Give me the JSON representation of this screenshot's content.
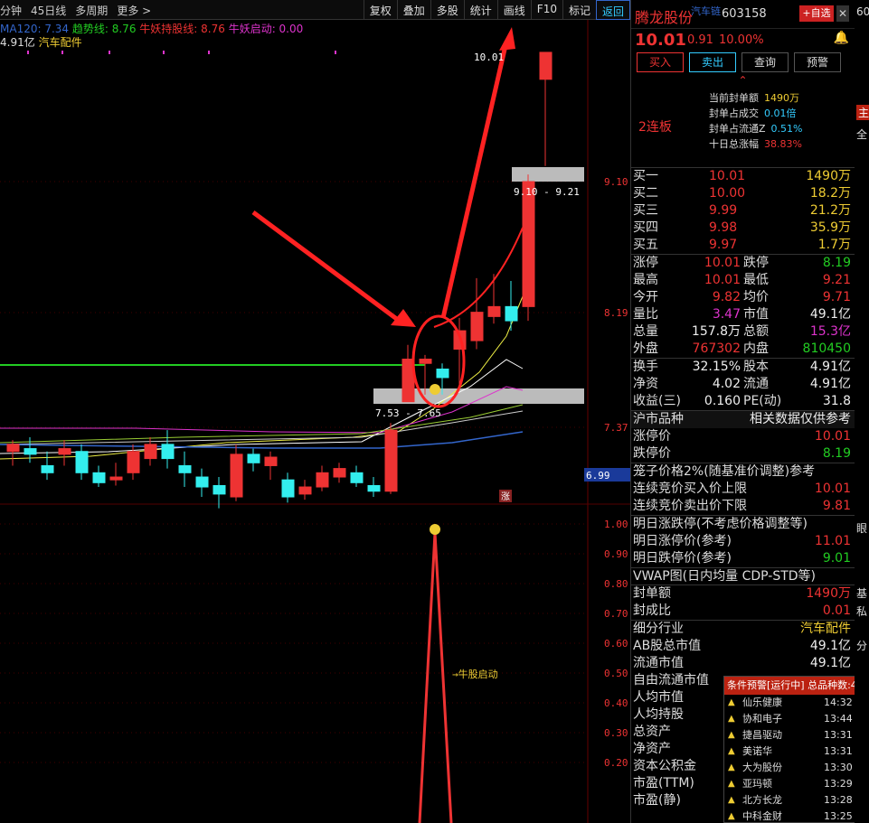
{
  "toolbar": {
    "left": [
      "分钟",
      "45日线",
      "多周期",
      "更多 >"
    ],
    "right": [
      "复权",
      "叠加",
      "多股",
      "统计",
      "画线",
      "F10",
      "标记",
      "返回"
    ]
  },
  "indicators": {
    "ma": "MA120: 7.34",
    "trend": "趋势线: 8.76",
    "holding": "牛妖持股线: 8.76",
    "start": "牛妖启动: 0.00",
    "cap": "4.91亿",
    "sector": "汽车配件"
  },
  "chart": {
    "price_labels": [
      "9.10",
      "8.19",
      "7.37"
    ],
    "current_price_tag": "6.99",
    "zone_top": "9.10 - 9.21",
    "zone_bottom": "7.53 - 7.65",
    "high_label": "10.01",
    "limit_tag": "涨",
    "lower_labels": [
      "1.00",
      "0.90",
      "0.80",
      "0.70",
      "0.60",
      "0.50",
      "0.40",
      "0.30",
      "0.20"
    ],
    "signal_text": "→牛股启动"
  },
  "chart_data": {
    "type": "candlestick",
    "candles": [
      {
        "o": 7.2,
        "c": 7.25,
        "h": 7.28,
        "l": 7.1
      },
      {
        "o": 7.22,
        "c": 7.18,
        "h": 7.3,
        "l": 7.12
      },
      {
        "o": 7.1,
        "c": 7.05,
        "h": 7.2,
        "l": 7.0
      },
      {
        "o": 7.18,
        "c": 7.22,
        "h": 7.28,
        "l": 7.1
      },
      {
        "o": 7.2,
        "c": 7.05,
        "h": 7.25,
        "l": 7.0
      },
      {
        "o": 7.05,
        "c": 6.98,
        "h": 7.1,
        "l": 6.95
      },
      {
        "o": 7.0,
        "c": 7.02,
        "h": 7.12,
        "l": 6.96
      },
      {
        "o": 7.05,
        "c": 7.2,
        "h": 7.25,
        "l": 7.0
      },
      {
        "o": 7.15,
        "c": 7.25,
        "h": 7.3,
        "l": 7.1
      },
      {
        "o": 7.25,
        "c": 7.15,
        "h": 7.35,
        "l": 7.08
      },
      {
        "o": 7.1,
        "c": 7.05,
        "h": 7.2,
        "l": 6.95
      },
      {
        "o": 7.02,
        "c": 6.95,
        "h": 7.08,
        "l": 6.88
      },
      {
        "o": 6.96,
        "c": 6.9,
        "h": 7.02,
        "l": 6.8
      },
      {
        "o": 6.88,
        "c": 7.18,
        "h": 7.25,
        "l": 6.85
      },
      {
        "o": 7.18,
        "c": 7.12,
        "h": 7.22,
        "l": 7.06
      },
      {
        "o": 7.1,
        "c": 7.16,
        "h": 7.2,
        "l": 7.0
      },
      {
        "o": 7.0,
        "c": 6.88,
        "h": 7.05,
        "l": 6.84
      },
      {
        "o": 6.9,
        "c": 6.95,
        "h": 7.0,
        "l": 6.86
      },
      {
        "o": 6.95,
        "c": 7.05,
        "h": 7.1,
        "l": 6.92
      },
      {
        "o": 7.02,
        "c": 7.08,
        "h": 7.12,
        "l": 6.98
      },
      {
        "o": 7.05,
        "c": 6.98,
        "h": 7.1,
        "l": 6.95
      },
      {
        "o": 6.96,
        "c": 6.92,
        "h": 7.02,
        "l": 6.88
      },
      {
        "o": 6.92,
        "c": 7.35,
        "h": 7.4,
        "l": 6.9
      },
      {
        "o": 7.55,
        "c": 7.85,
        "h": 7.95,
        "l": 7.55
      },
      {
        "o": 7.82,
        "c": 7.85,
        "h": 7.88,
        "l": 7.6
      },
      {
        "o": 7.78,
        "c": 7.72,
        "h": 7.82,
        "l": 7.6
      },
      {
        "o": 7.92,
        "c": 8.05,
        "h": 8.14,
        "l": 7.65
      },
      {
        "o": 7.98,
        "c": 8.18,
        "h": 8.42,
        "l": 7.92
      },
      {
        "o": 8.15,
        "c": 8.22,
        "h": 8.45,
        "l": 8.1
      },
      {
        "o": 8.22,
        "c": 8.12,
        "h": 8.4,
        "l": 8.05
      },
      {
        "o": 8.22,
        "c": 9.1,
        "h": 9.15,
        "l": 8.12
      },
      {
        "o": 9.82,
        "c": 10.01,
        "h": 10.01,
        "l": 9.21
      }
    ]
  },
  "panel": {
    "name": "腾龙股份",
    "sub": "汽车链",
    "code": "603158",
    "add_label": "+自选",
    "close": "✕",
    "price": "10.01",
    "change": "0.91",
    "pct": "10.00%",
    "buttons": [
      "买入",
      "卖出",
      "查询",
      "预警"
    ],
    "lianban": "2连板",
    "seal": [
      {
        "label": "当前封单额",
        "value": "1490万",
        "color": "yellow"
      },
      {
        "label": "封单占成交",
        "value": "0.01倍",
        "color": "cyan"
      },
      {
        "label": "封单占流通Z",
        "value": "0.51%",
        "color": "cyan"
      },
      {
        "label": "十日总涨幅",
        "value": "38.83%",
        "color": "red"
      }
    ],
    "book": [
      {
        "label": "买一",
        "price": "10.01",
        "vol": "1490万"
      },
      {
        "label": "买二",
        "price": "10.00",
        "vol": "18.2万"
      },
      {
        "label": "买三",
        "price": "9.99",
        "vol": "21.2万"
      },
      {
        "label": "买四",
        "price": "9.98",
        "vol": "35.9万"
      },
      {
        "label": "买五",
        "price": "9.97",
        "vol": "1.7万"
      }
    ],
    "stats": [
      {
        "l1": "涨停",
        "v1": "10.01",
        "c1": "red",
        "l2": "跌停",
        "v2": "8.19",
        "c2": "green"
      },
      {
        "l1": "最高",
        "v1": "10.01",
        "c1": "red",
        "l2": "最低",
        "v2": "9.21",
        "c2": "red"
      },
      {
        "l1": "今开",
        "v1": "9.82",
        "c1": "red",
        "l2": "均价",
        "v2": "9.71",
        "c2": "red"
      },
      {
        "l1": "量比",
        "v1": "3.47",
        "c1": "magenta",
        "l2": "市值",
        "v2": "49.1亿",
        "c2": "white"
      },
      {
        "l1": "总量",
        "v1": "157.8万",
        "c1": "white",
        "l2": "总额",
        "v2": "15.3亿",
        "c2": "magenta"
      },
      {
        "l1": "外盘",
        "v1": "767302",
        "c1": "red",
        "l2": "内盘",
        "v2": "810450",
        "c2": "green"
      }
    ],
    "stats2": [
      {
        "l1": "换手",
        "v1": "32.15%",
        "c1": "white",
        "l2": "股本",
        "v2": "4.91亿",
        "c2": "white"
      },
      {
        "l1": "净资",
        "v1": "4.02",
        "c1": "white",
        "l2": "流通",
        "v2": "4.91亿",
        "c2": "white"
      },
      {
        "l1": "收益(三)",
        "v1": "0.160",
        "c1": "white",
        "l2": "PE(动)",
        "v2": "31.8",
        "c2": "white"
      }
    ],
    "market_head_l": "沪市品种",
    "market_head_r": "相关数据仅供参考",
    "market": [
      {
        "l": "涨停价",
        "v": "10.01",
        "c": "red"
      },
      {
        "l": "跌停价",
        "v": "8.19",
        "c": "green"
      }
    ],
    "cage": [
      {
        "l": "笼子价格2%(随基准价调整)参考",
        "v": "",
        "c": "white"
      },
      {
        "l": "连续竞价买入价上限",
        "v": "10.01",
        "c": "red"
      },
      {
        "l": "连续竞价卖出价下限",
        "v": "9.81",
        "c": "red"
      }
    ],
    "tomorrow": [
      {
        "l": "明日涨跌停(不考虑价格调整等)",
        "v": "",
        "c": "white"
      },
      {
        "l": "明日涨停价(参考)",
        "v": "11.01",
        "c": "red"
      },
      {
        "l": "明日跌停价(参考)",
        "v": "9.01",
        "c": "green"
      }
    ],
    "vwap": "VWAP图(日内均量 CDP-STD等)",
    "seal2": [
      {
        "l": "封单额",
        "v": "1490万",
        "c": "red"
      },
      {
        "l": "封成比",
        "v": "0.01",
        "c": "red"
      }
    ],
    "industry": [
      {
        "l": "细分行业",
        "v": "汽车配件",
        "c": "yellow"
      },
      {
        "l": "AB股总市值",
        "v": "49.1亿",
        "c": "white"
      },
      {
        "l": "流通市值",
        "v": "49.1亿",
        "c": "white"
      },
      {
        "l": "自由流通市值",
        "v": "",
        "c": "white"
      },
      {
        "l": "人均市值",
        "v": "",
        "c": "white"
      },
      {
        "l": "人均持股",
        "v": "",
        "c": "white"
      },
      {
        "l": "总资产",
        "v": "",
        "c": "white"
      },
      {
        "l": "净资产",
        "v": "",
        "c": "white"
      },
      {
        "l": "资本公积金",
        "v": "",
        "c": "white"
      },
      {
        "l": "市盈(TTM)",
        "v": "",
        "c": "white"
      },
      {
        "l": "市盈(静)",
        "v": "",
        "c": "white"
      }
    ]
  },
  "alert": {
    "title": "条件预警[运行中] 总品种数:4",
    "items": [
      {
        "name": "仙乐健康",
        "time": "14:32"
      },
      {
        "name": "协和电子",
        "time": "13:44"
      },
      {
        "name": "捷昌驱动",
        "time": "13:31"
      },
      {
        "name": "美诺华",
        "time": "13:31"
      },
      {
        "name": "大为股份",
        "time": "13:30"
      },
      {
        "name": "亚玛顿",
        "time": "13:29"
      },
      {
        "name": "北方长龙",
        "time": "13:28"
      },
      {
        "name": "中科金财",
        "time": "13:25"
      }
    ]
  },
  "edge": {
    "top": "60",
    "tab": "主",
    "tab2": "全",
    "side": [
      "眼",
      "基",
      "私",
      "分"
    ]
  }
}
